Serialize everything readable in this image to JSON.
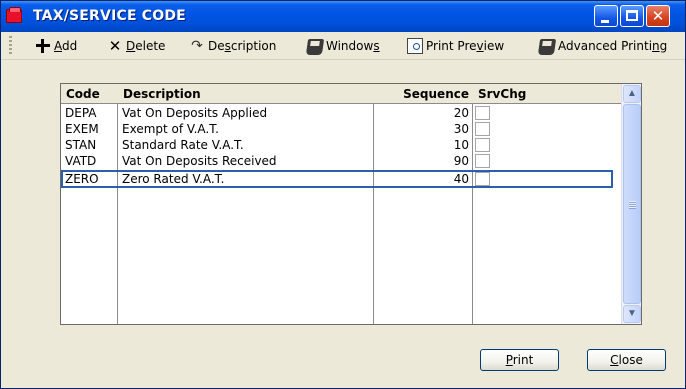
{
  "window": {
    "title": "TAX/SERVICE CODE"
  },
  "toolbar": {
    "add": {
      "mnemonic": "A",
      "rest": "dd"
    },
    "delete": {
      "mnemonic": "D",
      "rest": "elete"
    },
    "description": {
      "pre": "De",
      "mnemonic": "s",
      "post": "cription"
    },
    "windows": {
      "pre": "Window",
      "mnemonic": "s",
      "post": ""
    },
    "print_preview": {
      "pre": "Print Pre",
      "mnemonic": "v",
      "post": "iew"
    },
    "advanced_printing": {
      "pre": "Advanced Printi",
      "mnemonic": "n",
      "post": "g"
    }
  },
  "table": {
    "headers": {
      "code": "Code",
      "description": "Description",
      "sequence": "Sequence",
      "srvchg": "SrvChg"
    },
    "rows": [
      {
        "code": "DEPA",
        "description": "Vat On Deposits Applied",
        "sequence": "20",
        "srvchg": false
      },
      {
        "code": "EXEM",
        "description": "Exempt of V.A.T.",
        "sequence": "30",
        "srvchg": false
      },
      {
        "code": "STAN",
        "description": "Standard Rate V.A.T.",
        "sequence": "10",
        "srvchg": false
      },
      {
        "code": "VATD",
        "description": "Vat On Deposits Received",
        "sequence": "90",
        "srvchg": false
      },
      {
        "code": "ZERO",
        "description": "Zero Rated V.A.T.",
        "sequence": "40",
        "srvchg": false
      }
    ],
    "selected_row": 4
  },
  "buttons": {
    "print": {
      "mnemonic": "P",
      "rest": "rint"
    },
    "close": {
      "mnemonic": "C",
      "rest": "lose"
    }
  },
  "icons": {
    "window": "app-icon",
    "add": "plus-icon",
    "delete": "x-icon",
    "description": "description-arrow-icon",
    "windows": "windows-icon",
    "print_preview": "print-preview-icon",
    "advanced_printing": "printer-icon"
  },
  "colors": {
    "titlebar": "#0054e3",
    "selection_border": "#2a5fae",
    "window_bg": "#ece9d8"
  }
}
